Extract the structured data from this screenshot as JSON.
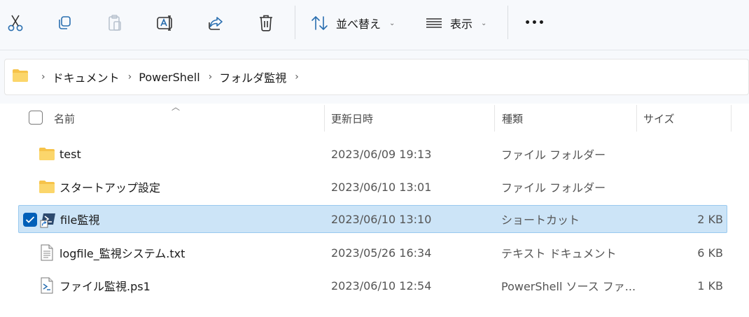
{
  "toolbar": {
    "cut_icon": "scissors-icon",
    "copy_icon": "copy-icon",
    "paste_icon": "paste-icon",
    "rename_icon": "rename-icon",
    "share_icon": "share-icon",
    "delete_icon": "trash-icon",
    "sort_label": "並べ替え",
    "view_label": "表示",
    "more_label": "•••"
  },
  "breadcrumb": [
    "ドキュメント",
    "PowerShell",
    "フォルダ監視"
  ],
  "columns": {
    "name": "名前",
    "modified": "更新日時",
    "type": "種類",
    "size": "サイズ"
  },
  "files": [
    {
      "name": "test",
      "modified": "2023/06/09 19:13",
      "type": "ファイル フォルダー",
      "size": "",
      "icon": "folder-icon",
      "selected": false
    },
    {
      "name": "スタートアップ設定",
      "modified": "2023/06/10 13:01",
      "type": "ファイル フォルダー",
      "size": "",
      "icon": "folder-icon",
      "selected": false
    },
    {
      "name": "file監視",
      "modified": "2023/06/10 13:10",
      "type": "ショートカット",
      "size": "2 KB",
      "icon": "powershell-shortcut-icon",
      "selected": true
    },
    {
      "name": "logfile_監視システム.txt",
      "modified": "2023/05/26 16:34",
      "type": "テキスト ドキュメント",
      "size": "6 KB",
      "icon": "text-file-icon",
      "selected": false
    },
    {
      "name": "ファイル監視.ps1",
      "modified": "2023/06/10 12:54",
      "type": "PowerShell ソース ファ...",
      "size": "1 KB",
      "icon": "ps1-file-icon",
      "selected": false
    }
  ],
  "colors": {
    "accent": "#005fb8",
    "selection_bg": "#cce4f7",
    "folder": "#f6c34a"
  }
}
